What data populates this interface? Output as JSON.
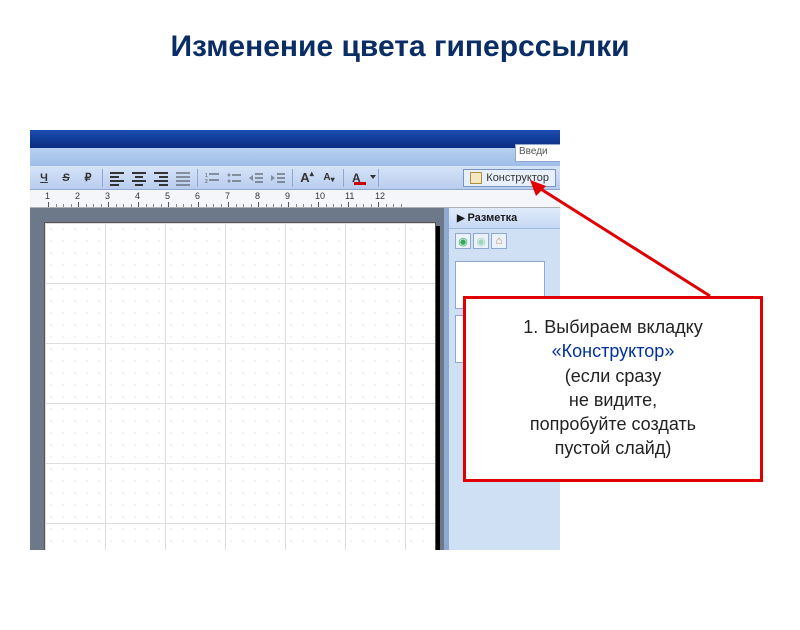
{
  "title": "Изменение цвета гиперссылки",
  "toolbar": {
    "underline": "Ч",
    "strike": "S",
    "currency": "₽",
    "font_grow": "A",
    "font_shrink": "A",
    "font_color_letter": "A",
    "designer_label": "Конструктор"
  },
  "search_placeholder": "Введи",
  "ruler_numbers": [
    "1",
    "2",
    "3",
    "4",
    "5",
    "6",
    "7",
    "8",
    "9",
    "10",
    "11",
    "12"
  ],
  "taskpane": {
    "header": "Разметка"
  },
  "callout": {
    "number": "1.",
    "line1": "Выбираем вкладку",
    "line2": "«Конструктор»",
    "line3": "(если сразу",
    "line4": "не видите,",
    "line5": "попробуйте создать",
    "line6": "пустой слайд)"
  }
}
